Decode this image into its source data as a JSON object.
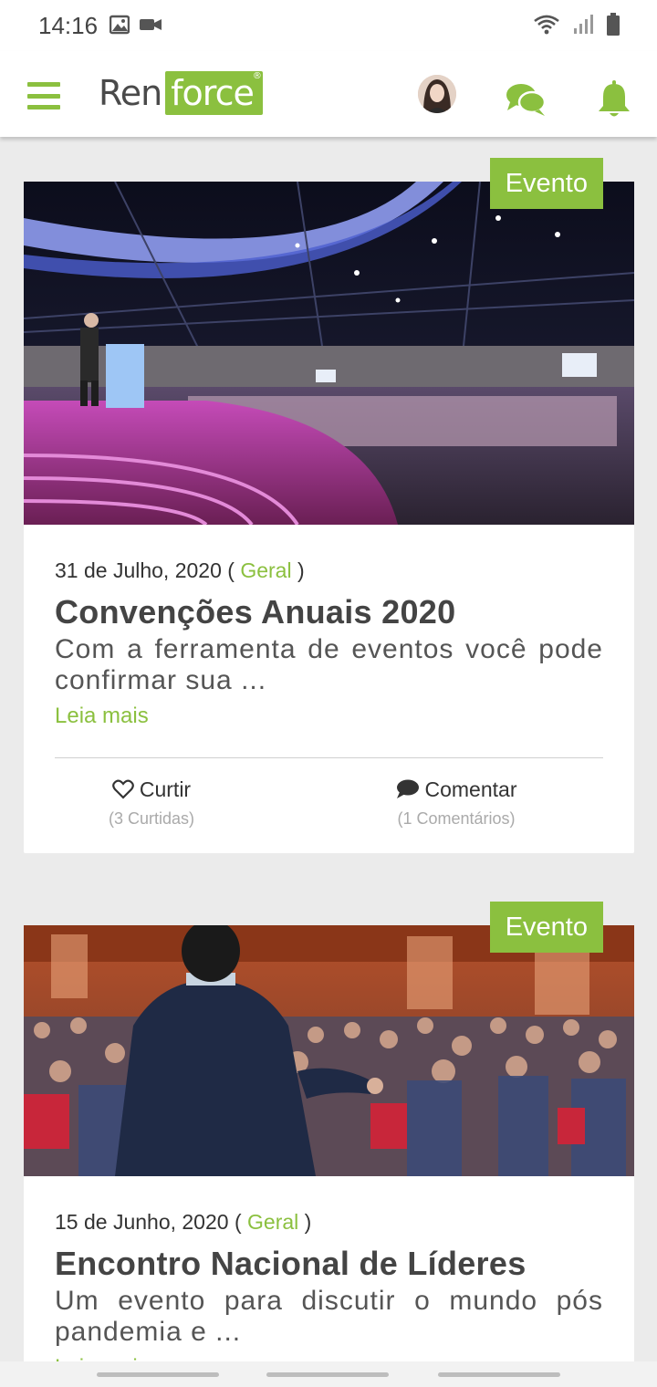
{
  "status_bar": {
    "time": "14:16"
  },
  "header": {
    "logo_left": "Ren",
    "logo_right": "force",
    "logo_mark": "®"
  },
  "posts": [
    {
      "badge": "Evento",
      "date": "31 de Julho, 2020",
      "category": "Geral",
      "title": "Convenções Anuais 2020",
      "excerpt": "Com a ferramenta de eventos você pode confirmar sua ...",
      "read_more": "Leia mais",
      "like_label": "Curtir",
      "like_count": "(3 Curtidas)",
      "comment_label": "Comentar",
      "comment_count": "(1 Comentários)"
    },
    {
      "badge": "Evento",
      "date": "15 de Junho, 2020",
      "category": "Geral",
      "title": "Encontro Nacional de Líderes",
      "excerpt": "Um evento para discutir o mundo pós pandemia e ...",
      "read_more": "Leia mais"
    }
  ],
  "colors": {
    "accent": "#8bc03f",
    "background": "#ebebeb"
  }
}
